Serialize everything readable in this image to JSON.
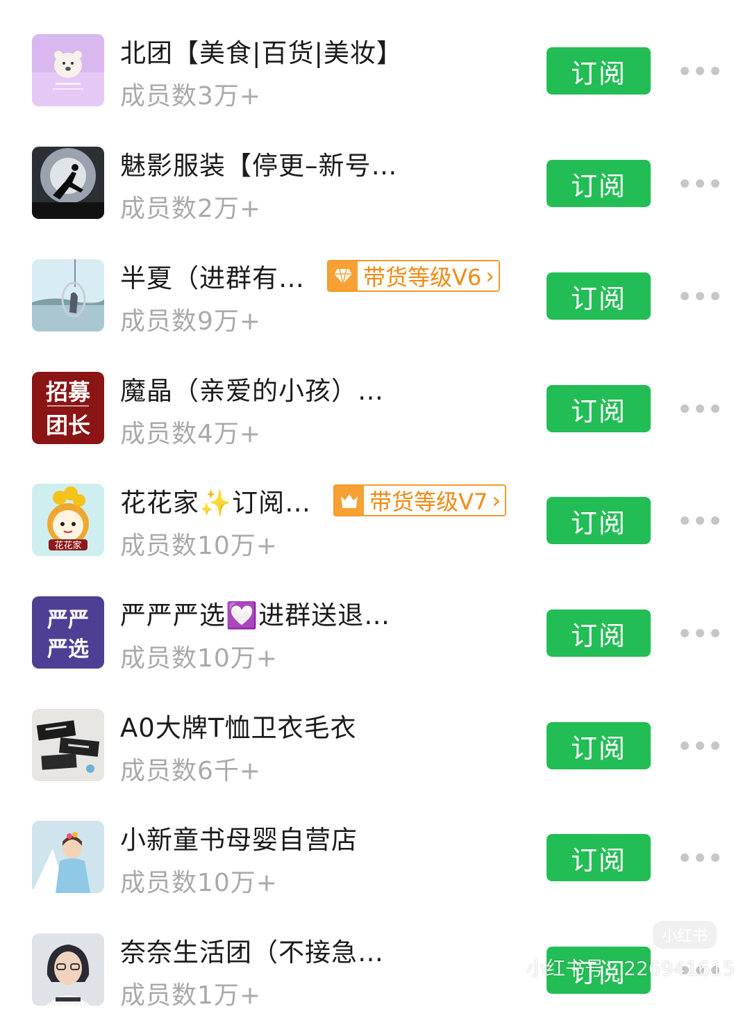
{
  "groups": [
    {
      "name": "北团【美食|百货|美妆】",
      "members": "成员数3万+",
      "badge": null,
      "subscribe_label": "订阅",
      "avatar": "polar-bear-avatar"
    },
    {
      "name": "魅影服装【停更–新号…",
      "members": "成员数2万+",
      "badge": null,
      "subscribe_label": "订阅",
      "avatar": "jumping-silhouette-avatar"
    },
    {
      "name": "半夏（进群有…",
      "members": "成员数9万+",
      "badge": {
        "text": "带货等级V6",
        "icon": "diamond-icon"
      },
      "subscribe_label": "订阅",
      "avatar": "swing-lake-avatar"
    },
    {
      "name": "魔晶（亲爱的小孩）…",
      "members": "成员数4万+",
      "badge": null,
      "subscribe_label": "订阅",
      "avatar": "recruit-leader-avatar",
      "avatar_text": [
        "招募",
        "团长"
      ]
    },
    {
      "name": "花花家✨订阅…",
      "members": "成员数10万+",
      "badge": {
        "text": "带货等级V7",
        "icon": "crown-icon"
      },
      "subscribe_label": "订阅",
      "avatar": "flower-girl-avatar",
      "avatar_text": [
        "花花家"
      ]
    },
    {
      "name": "严严严选💟进群送退…",
      "members": "成员数10万+",
      "badge": null,
      "subscribe_label": "订阅",
      "avatar": "yanyan-select-avatar",
      "avatar_text": [
        "严严",
        "严选"
      ]
    },
    {
      "name": "A0大牌T恤卫衣毛衣",
      "members": "成员数6千+",
      "badge": null,
      "subscribe_label": "订阅",
      "avatar": "clothing-tags-avatar"
    },
    {
      "name": "小新童书母婴自营店",
      "members": "成员数10万+",
      "badge": null,
      "subscribe_label": "订阅",
      "avatar": "child-photo-avatar"
    },
    {
      "name": "奈奈生活团（不接急…",
      "members": "成员数1万+",
      "badge": null,
      "subscribe_label": "订阅",
      "avatar": "woman-portrait-avatar"
    }
  ],
  "watermark": {
    "logo": "小红书",
    "text": "小红书号：226941615"
  },
  "colors": {
    "subscribe_green": "#23bd55",
    "badge_orange": "#f39a2b",
    "member_gray": "#a9a9a9"
  }
}
